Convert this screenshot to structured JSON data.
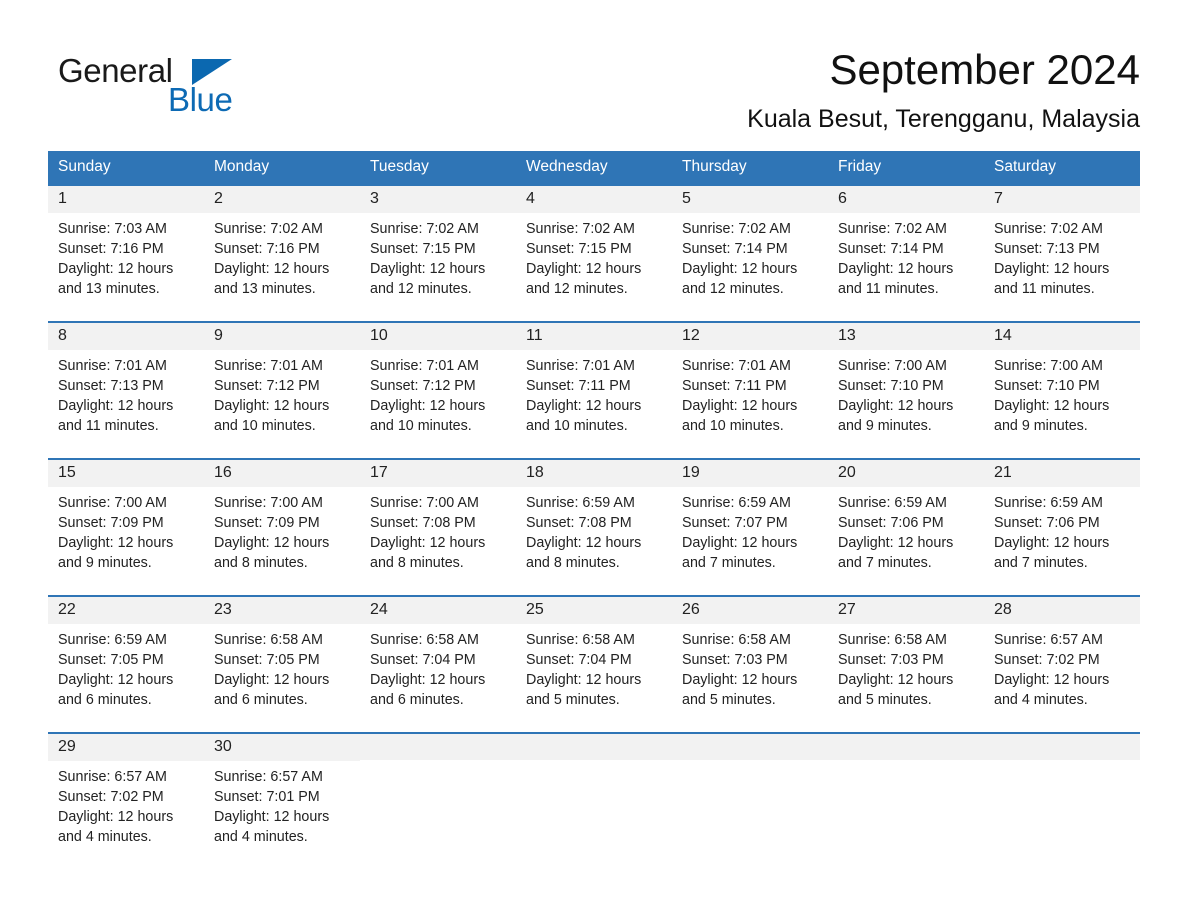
{
  "brand": {
    "name_dark": "General",
    "name_light": "Blue",
    "accent_color": "#0d6ab4",
    "triangle_icon": "triangle-icon"
  },
  "header": {
    "month_title": "September 2024",
    "location": "Kuala Besut, Terengganu, Malaysia"
  },
  "calendar": {
    "header_color": "#2f75b6",
    "daynum_band_color": "#f2f2f2",
    "weekday_headers": [
      "Sunday",
      "Monday",
      "Tuesday",
      "Wednesday",
      "Thursday",
      "Friday",
      "Saturday"
    ],
    "weeks": [
      [
        {
          "date": "1",
          "sunrise": "Sunrise: 7:03 AM",
          "sunset": "Sunset: 7:16 PM",
          "daylight_line1": "Daylight: 12 hours",
          "daylight_line2": "and 13 minutes."
        },
        {
          "date": "2",
          "sunrise": "Sunrise: 7:02 AM",
          "sunset": "Sunset: 7:16 PM",
          "daylight_line1": "Daylight: 12 hours",
          "daylight_line2": "and 13 minutes."
        },
        {
          "date": "3",
          "sunrise": "Sunrise: 7:02 AM",
          "sunset": "Sunset: 7:15 PM",
          "daylight_line1": "Daylight: 12 hours",
          "daylight_line2": "and 12 minutes."
        },
        {
          "date": "4",
          "sunrise": "Sunrise: 7:02 AM",
          "sunset": "Sunset: 7:15 PM",
          "daylight_line1": "Daylight: 12 hours",
          "daylight_line2": "and 12 minutes."
        },
        {
          "date": "5",
          "sunrise": "Sunrise: 7:02 AM",
          "sunset": "Sunset: 7:14 PM",
          "daylight_line1": "Daylight: 12 hours",
          "daylight_line2": "and 12 minutes."
        },
        {
          "date": "6",
          "sunrise": "Sunrise: 7:02 AM",
          "sunset": "Sunset: 7:14 PM",
          "daylight_line1": "Daylight: 12 hours",
          "daylight_line2": "and 11 minutes."
        },
        {
          "date": "7",
          "sunrise": "Sunrise: 7:02 AM",
          "sunset": "Sunset: 7:13 PM",
          "daylight_line1": "Daylight: 12 hours",
          "daylight_line2": "and 11 minutes."
        }
      ],
      [
        {
          "date": "8",
          "sunrise": "Sunrise: 7:01 AM",
          "sunset": "Sunset: 7:13 PM",
          "daylight_line1": "Daylight: 12 hours",
          "daylight_line2": "and 11 minutes."
        },
        {
          "date": "9",
          "sunrise": "Sunrise: 7:01 AM",
          "sunset": "Sunset: 7:12 PM",
          "daylight_line1": "Daylight: 12 hours",
          "daylight_line2": "and 10 minutes."
        },
        {
          "date": "10",
          "sunrise": "Sunrise: 7:01 AM",
          "sunset": "Sunset: 7:12 PM",
          "daylight_line1": "Daylight: 12 hours",
          "daylight_line2": "and 10 minutes."
        },
        {
          "date": "11",
          "sunrise": "Sunrise: 7:01 AM",
          "sunset": "Sunset: 7:11 PM",
          "daylight_line1": "Daylight: 12 hours",
          "daylight_line2": "and 10 minutes."
        },
        {
          "date": "12",
          "sunrise": "Sunrise: 7:01 AM",
          "sunset": "Sunset: 7:11 PM",
          "daylight_line1": "Daylight: 12 hours",
          "daylight_line2": "and 10 minutes."
        },
        {
          "date": "13",
          "sunrise": "Sunrise: 7:00 AM",
          "sunset": "Sunset: 7:10 PM",
          "daylight_line1": "Daylight: 12 hours",
          "daylight_line2": "and 9 minutes."
        },
        {
          "date": "14",
          "sunrise": "Sunrise: 7:00 AM",
          "sunset": "Sunset: 7:10 PM",
          "daylight_line1": "Daylight: 12 hours",
          "daylight_line2": "and 9 minutes."
        }
      ],
      [
        {
          "date": "15",
          "sunrise": "Sunrise: 7:00 AM",
          "sunset": "Sunset: 7:09 PM",
          "daylight_line1": "Daylight: 12 hours",
          "daylight_line2": "and 9 minutes."
        },
        {
          "date": "16",
          "sunrise": "Sunrise: 7:00 AM",
          "sunset": "Sunset: 7:09 PM",
          "daylight_line1": "Daylight: 12 hours",
          "daylight_line2": "and 8 minutes."
        },
        {
          "date": "17",
          "sunrise": "Sunrise: 7:00 AM",
          "sunset": "Sunset: 7:08 PM",
          "daylight_line1": "Daylight: 12 hours",
          "daylight_line2": "and 8 minutes."
        },
        {
          "date": "18",
          "sunrise": "Sunrise: 6:59 AM",
          "sunset": "Sunset: 7:08 PM",
          "daylight_line1": "Daylight: 12 hours",
          "daylight_line2": "and 8 minutes."
        },
        {
          "date": "19",
          "sunrise": "Sunrise: 6:59 AM",
          "sunset": "Sunset: 7:07 PM",
          "daylight_line1": "Daylight: 12 hours",
          "daylight_line2": "and 7 minutes."
        },
        {
          "date": "20",
          "sunrise": "Sunrise: 6:59 AM",
          "sunset": "Sunset: 7:06 PM",
          "daylight_line1": "Daylight: 12 hours",
          "daylight_line2": "and 7 minutes."
        },
        {
          "date": "21",
          "sunrise": "Sunrise: 6:59 AM",
          "sunset": "Sunset: 7:06 PM",
          "daylight_line1": "Daylight: 12 hours",
          "daylight_line2": "and 7 minutes."
        }
      ],
      [
        {
          "date": "22",
          "sunrise": "Sunrise: 6:59 AM",
          "sunset": "Sunset: 7:05 PM",
          "daylight_line1": "Daylight: 12 hours",
          "daylight_line2": "and 6 minutes."
        },
        {
          "date": "23",
          "sunrise": "Sunrise: 6:58 AM",
          "sunset": "Sunset: 7:05 PM",
          "daylight_line1": "Daylight: 12 hours",
          "daylight_line2": "and 6 minutes."
        },
        {
          "date": "24",
          "sunrise": "Sunrise: 6:58 AM",
          "sunset": "Sunset: 7:04 PM",
          "daylight_line1": "Daylight: 12 hours",
          "daylight_line2": "and 6 minutes."
        },
        {
          "date": "25",
          "sunrise": "Sunrise: 6:58 AM",
          "sunset": "Sunset: 7:04 PM",
          "daylight_line1": "Daylight: 12 hours",
          "daylight_line2": "and 5 minutes."
        },
        {
          "date": "26",
          "sunrise": "Sunrise: 6:58 AM",
          "sunset": "Sunset: 7:03 PM",
          "daylight_line1": "Daylight: 12 hours",
          "daylight_line2": "and 5 minutes."
        },
        {
          "date": "27",
          "sunrise": "Sunrise: 6:58 AM",
          "sunset": "Sunset: 7:03 PM",
          "daylight_line1": "Daylight: 12 hours",
          "daylight_line2": "and 5 minutes."
        },
        {
          "date": "28",
          "sunrise": "Sunrise: 6:57 AM",
          "sunset": "Sunset: 7:02 PM",
          "daylight_line1": "Daylight: 12 hours",
          "daylight_line2": "and 4 minutes."
        }
      ],
      [
        {
          "date": "29",
          "sunrise": "Sunrise: 6:57 AM",
          "sunset": "Sunset: 7:02 PM",
          "daylight_line1": "Daylight: 12 hours",
          "daylight_line2": "and 4 minutes."
        },
        {
          "date": "30",
          "sunrise": "Sunrise: 6:57 AM",
          "sunset": "Sunset: 7:01 PM",
          "daylight_line1": "Daylight: 12 hours",
          "daylight_line2": "and 4 minutes."
        },
        {
          "date": "",
          "sunrise": "",
          "sunset": "",
          "daylight_line1": "",
          "daylight_line2": ""
        },
        {
          "date": "",
          "sunrise": "",
          "sunset": "",
          "daylight_line1": "",
          "daylight_line2": ""
        },
        {
          "date": "",
          "sunrise": "",
          "sunset": "",
          "daylight_line1": "",
          "daylight_line2": ""
        },
        {
          "date": "",
          "sunrise": "",
          "sunset": "",
          "daylight_line1": "",
          "daylight_line2": ""
        },
        {
          "date": "",
          "sunrise": "",
          "sunset": "",
          "daylight_line1": "",
          "daylight_line2": ""
        }
      ]
    ]
  }
}
